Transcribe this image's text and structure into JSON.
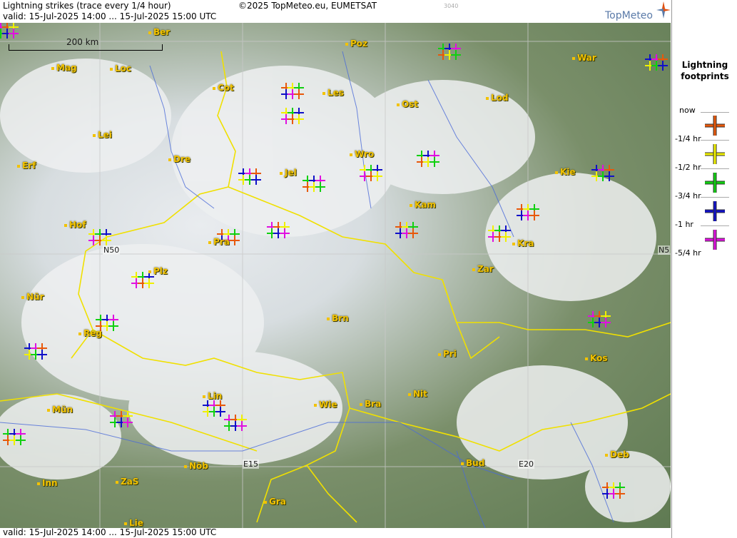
{
  "header": {
    "title": "Lightning strikes (trace every 1/4 hour)",
    "copyright": "©2025 TopMeteo.eu, EUMETSAT",
    "valid_top": "valid:  15-Jul-2025 14:00 ... 15-Jul-2025 15:00 UTC",
    "valid_bottom": "valid:  15-Jul-2025 14:00 ... 15-Jul-2025 15:00 UTC",
    "small_code": "3040",
    "logo": "TopMeteo"
  },
  "scale": {
    "label": "200 km"
  },
  "grid_labels": [
    "N50",
    "E15",
    "E20",
    "N5"
  ],
  "cities": [
    {
      "name": "Ber"
    },
    {
      "name": "Poz"
    },
    {
      "name": "War"
    },
    {
      "name": "Mag"
    },
    {
      "name": "Loc"
    },
    {
      "name": "Cot"
    },
    {
      "name": "Les"
    },
    {
      "name": "Ost"
    },
    {
      "name": "Lod"
    },
    {
      "name": "Lei"
    },
    {
      "name": "Dre"
    },
    {
      "name": "Wro"
    },
    {
      "name": "Erf"
    },
    {
      "name": "Jel"
    },
    {
      "name": "Kie"
    },
    {
      "name": "Kam"
    },
    {
      "name": "Hof"
    },
    {
      "name": "Pra"
    },
    {
      "name": "Kra"
    },
    {
      "name": "Plz"
    },
    {
      "name": "Zar"
    },
    {
      "name": "Nür"
    },
    {
      "name": "Brn"
    },
    {
      "name": "Reg"
    },
    {
      "name": "Kos"
    },
    {
      "name": "Pri"
    },
    {
      "name": "Lin"
    },
    {
      "name": "Nit"
    },
    {
      "name": "Wie"
    },
    {
      "name": "Bra"
    },
    {
      "name": "Mün"
    },
    {
      "name": "Deb"
    },
    {
      "name": "Nöb"
    },
    {
      "name": "Bud"
    },
    {
      "name": "Inn"
    },
    {
      "name": "ZaS"
    },
    {
      "name": "Gra"
    },
    {
      "name": "Lie"
    }
  ],
  "legend": {
    "title_line1": "Lightning",
    "title_line2": "footprints",
    "entries": [
      {
        "label": "now",
        "color": ""
      },
      {
        "label": "-1/4 hr",
        "color": "#e8580a"
      },
      {
        "label": "-1/2 hr",
        "color": "#f0f000"
      },
      {
        "label": "-3/4 hr",
        "color": "#10d010"
      },
      {
        "label": "-1 hr",
        "color": "#1010c8"
      },
      {
        "label": "-5/4 hr",
        "color": "#e010e0"
      }
    ]
  },
  "colors": {
    "borders": "#f0e000",
    "rivers": "#4a6ad8",
    "grid": "#c8c8c8"
  }
}
